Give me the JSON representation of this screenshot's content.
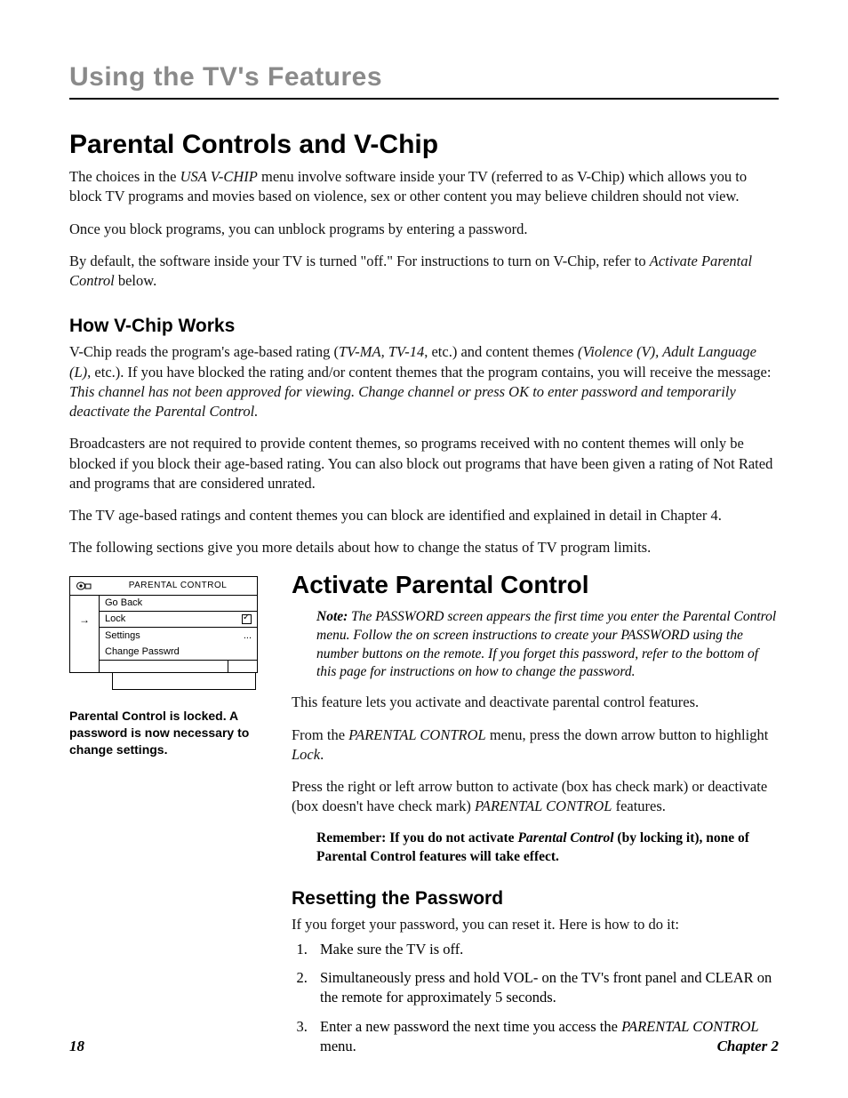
{
  "chapter_heading": "Using the TV's Features",
  "h1": "Parental Controls and V-Chip",
  "p1_a": "The choices in the ",
  "p1_b": "USA V-CHIP",
  "p1_c": " menu involve software inside your TV (referred to as V-Chip) which allows you to block TV programs and movies based on violence, sex or other content you may believe children should not view.",
  "p2": "Once you block programs, you can unblock programs by entering a password.",
  "p3_a": "By default, the software inside your TV is turned \"off.\" For instructions to turn on V-Chip, refer to ",
  "p3_b": "Activate Parental Control",
  "p3_c": " below.",
  "h2_how": "How V-Chip Works",
  "how_p1_a": "V-Chip reads the program's age-based rating (",
  "how_p1_b": "TV-MA, TV-14",
  "how_p1_c": ", etc.) and content themes ",
  "how_p1_d": "(Violence (V), Adult Language (L)",
  "how_p1_e": ", etc.). If you have blocked the rating and/or content themes that the program contains, you will receive the message: ",
  "how_p1_f": "This channel has not been approved for viewing. Change channel or press OK to enter password and temporarily deactivate the Parental Control.",
  "how_p2": "Broadcasters are not required to provide content themes, so programs received with no content themes will only be blocked if you block their age-based rating. You can also block out programs that have been given a rating of Not Rated and programs that are considered unrated.",
  "how_p3": "The TV age-based ratings and content themes you can block are identified and explained in detail in Chapter 4.",
  "how_p4": "The following sections give you more details about how to change the status of TV program limits.",
  "menu": {
    "title": "PARENTAL CONTROL",
    "items": [
      {
        "label": "Go Back",
        "right": ""
      },
      {
        "label": "Lock",
        "right": "check"
      },
      {
        "label": "Settings",
        "right": "..."
      },
      {
        "label": "Change Passwrd",
        "right": ""
      }
    ],
    "caption": "Parental Control is locked. A password is now necessary to change settings."
  },
  "activate": {
    "heading": "Activate Parental Control",
    "note_label": "Note:",
    "note_text": " The PASSWORD screen appears the first time you enter the Parental Control menu. Follow the on screen instructions to create your PASSWORD using the number buttons on the remote. If you forget this password, refer to the bottom of this page for instructions on how to change the password.",
    "p1": "This feature lets you activate and deactivate parental control features.",
    "p2_a": "From the ",
    "p2_b": "PARENTAL CONTROL",
    "p2_c": " menu, press the down arrow button to highlight ",
    "p2_d": "Lock",
    "p2_e": ".",
    "p3_a": "Press the right or left arrow button to activate (box has check mark) or deactivate (box doesn't have check mark) ",
    "p3_b": "PARENTAL CONTROL",
    "p3_c": " features.",
    "remember_a": "Remember: If you do not activate ",
    "remember_b": "Parental Control",
    "remember_c": " (by locking it), none of Parental Control features will take effect."
  },
  "reset": {
    "heading": "Resetting the Password",
    "intro": "If you forget your password, you can reset it. Here is how to do it:",
    "steps": [
      "Make sure the TV is off.",
      "Simultaneously press and hold VOL- on the TV's front panel and CLEAR on the remote for approximately 5 seconds.",
      {
        "a": "Enter a new password the next time you access the ",
        "b": "PARENTAL CONTROL",
        "c": " menu."
      }
    ]
  },
  "footer": {
    "page": "18",
    "chapter": "Chapter 2"
  }
}
